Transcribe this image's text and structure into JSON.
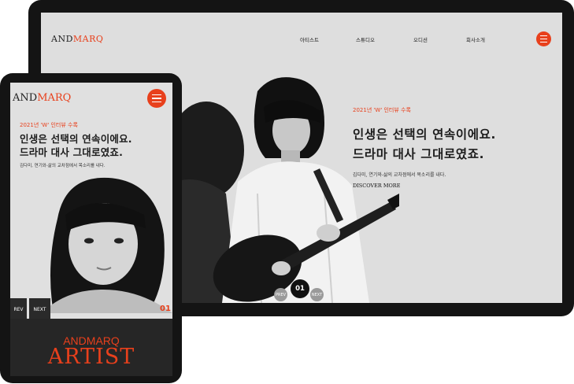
{
  "brand": {
    "part1": "AND",
    "part2": "MARQ",
    "accent_color": "#e8401c"
  },
  "desktop": {
    "nav": [
      "아티스트",
      "스튜디오",
      "오디션",
      "회사소개"
    ],
    "hero": {
      "sub": "2021년 'W' 인터뷰 수록",
      "headline_line1": "인생은 선택의 연속이에요.",
      "headline_line2": "드라마 대사 그대로였죠.",
      "desc": "김다미, 연기와-삶의 교차점에서 목소리를 내다.",
      "more": "DISCOVER MORE"
    },
    "slider": {
      "prev": "PREV",
      "current": "01",
      "next": "NEXT"
    },
    "menu_icon": "hamburger-icon"
  },
  "tablet": {
    "hero": {
      "sub": "2021년 'W' 인터뷰 수록",
      "headline_line1": "인생은 선택의 연속이에요.",
      "headline_line2": "드라마 대사 그대로였죠.",
      "desc": "김다미, 연기와-삶의 교차점에서 목소리를 내다."
    },
    "slider": {
      "prev": "REV",
      "next": "NEXT",
      "current": "01"
    },
    "footer": {
      "brand": "ANDMARQ",
      "title": "ARTIST"
    },
    "menu_icon": "hamburger-icon"
  }
}
